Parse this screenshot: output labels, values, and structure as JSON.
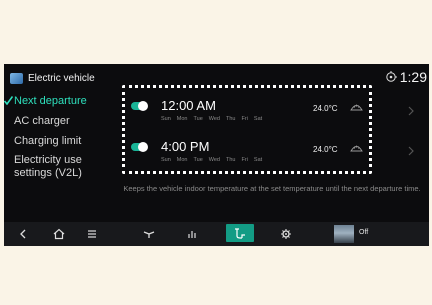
{
  "header": {
    "title": "Electric vehicle",
    "time": "1:29"
  },
  "sidebar": {
    "items": [
      {
        "label": "Next departure",
        "active": true
      },
      {
        "label": "AC charger"
      },
      {
        "label": "Charging limit"
      },
      {
        "label": "Electricity use settings (V2L)"
      }
    ]
  },
  "schedules": [
    {
      "time": "12:00 AM",
      "enabled": true,
      "temperature": "24.0°C",
      "days": [
        "Sun",
        "Mon",
        "Tue",
        "Wed",
        "Thu",
        "Fri",
        "Sat"
      ]
    },
    {
      "time": "4:00 PM",
      "enabled": true,
      "temperature": "24.0°C",
      "days": [
        "Sun",
        "Mon",
        "Tue",
        "Wed",
        "Thu",
        "Fri",
        "Sat"
      ]
    }
  ],
  "hint": "Keeps the vehicle indoor temperature at the set temperature until the next departure time.",
  "bottom_bar": {
    "media_label": "Off"
  },
  "colors": {
    "accent": "#2ee0bd",
    "toggle_on": "#19b597",
    "active_tab": "#139c85"
  }
}
